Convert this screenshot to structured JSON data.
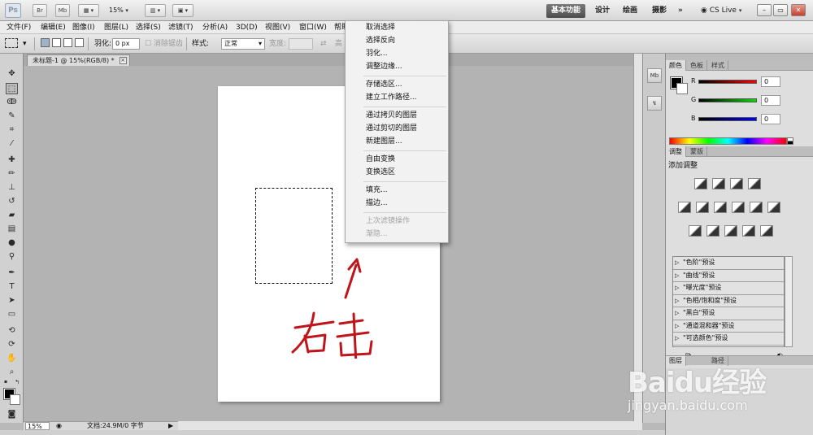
{
  "appbar": {
    "logo": "Ps",
    "bridge_btn": "Br",
    "minibridge_btn": "Mb",
    "zoom": "15%",
    "workspaces": [
      "基本功能",
      "设计",
      "绘画",
      "摄影"
    ],
    "more_workspaces": "»",
    "cslive": "CS Live"
  },
  "menubar": {
    "items": [
      "文件(F)",
      "编辑(E)",
      "图像(I)",
      "图层(L)",
      "选择(S)",
      "滤镜(T)",
      "分析(A)",
      "3D(D)",
      "视图(V)",
      "窗口(W)",
      "帮助"
    ]
  },
  "options": {
    "feather_label": "羽化:",
    "feather_value": "0 px",
    "antialias_label": "消除锯齿",
    "style_label": "样式:",
    "style_value": "正常",
    "width_label": "宽度:",
    "height_label": "高"
  },
  "document": {
    "tab_title": "未标题-1 @ 15%(RGB/8) *",
    "annotation_text": "右击"
  },
  "context_menu": {
    "groups": [
      [
        "取消选择",
        "选择反向",
        "羽化...",
        "调整边缘..."
      ],
      [
        "存储选区...",
        "建立工作路径..."
      ],
      [
        "通过拷贝的图层",
        "通过剪切的图层",
        "新建图层..."
      ],
      [
        "自由变换",
        "变换选区"
      ],
      [
        "填充...",
        "描边..."
      ],
      [
        "上次滤镜操作",
        "渐隐..."
      ]
    ]
  },
  "panels": {
    "color_tabs": [
      "颜色",
      "色板",
      "样式"
    ],
    "rgb": [
      {
        "channel": "R",
        "value": "0"
      },
      {
        "channel": "G",
        "value": "0"
      },
      {
        "channel": "B",
        "value": "0"
      }
    ],
    "adj_tabs": [
      "调整",
      "蒙版"
    ],
    "adj_title": "添加调整",
    "presets": [
      "\"色阶\"预设",
      "\"曲线\"预设",
      "\"曝光度\"预设",
      "\"色相/饱和度\"预设",
      "\"黑白\"预设",
      "\"通道混和器\"预设",
      "\"可选颜色\"预设"
    ],
    "bottom_tabs": [
      "图层",
      "路径"
    ]
  },
  "status": {
    "zoom": "15%",
    "doc": "文档:24.9M/0 字节"
  },
  "watermark": {
    "brand": "Baidu经验",
    "url": "jingyan.baidu.com"
  }
}
